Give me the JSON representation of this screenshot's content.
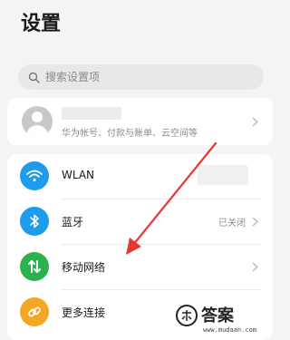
{
  "header": {
    "title": "设置"
  },
  "search": {
    "placeholder": "搜索设置项"
  },
  "account": {
    "name": "",
    "subtitle": "华为帐号、付款与账单、云空间等"
  },
  "settings": {
    "items": [
      {
        "label": "WLAN",
        "value": "",
        "icon": "wifi-icon",
        "color": "#1e9bea"
      },
      {
        "label": "蓝牙",
        "value": "已关闭",
        "icon": "bluetooth-icon",
        "color": "#1e9bea"
      },
      {
        "label": "移动网络",
        "value": "",
        "icon": "mobile-data-icon",
        "color": "#2bb24c"
      },
      {
        "label": "更多连接",
        "value": "",
        "icon": "link-icon",
        "color": "#f5a623"
      }
    ]
  },
  "annotation": {
    "color": "#e53935"
  },
  "watermark": {
    "brand": "答案",
    "url": "www.mudaan.com"
  }
}
